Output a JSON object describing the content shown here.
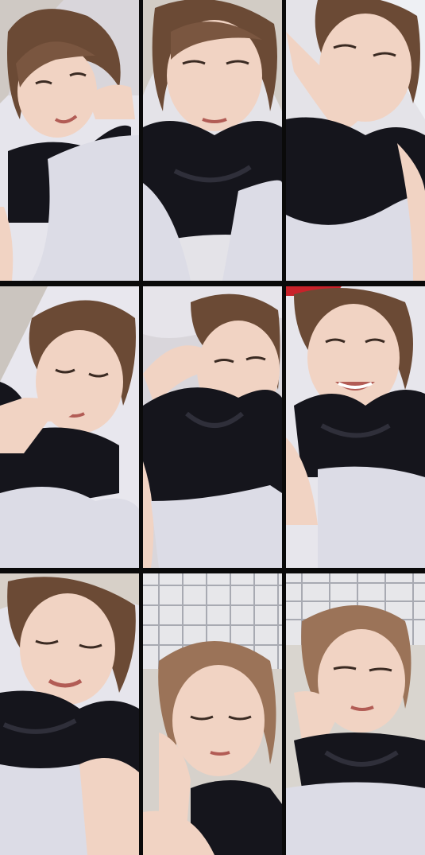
{
  "collage": {
    "rows": 3,
    "columns": 3,
    "panels": [
      {
        "name": "panel-1",
        "scene": "bed",
        "pose": "hand-near-chin"
      },
      {
        "name": "panel-2",
        "scene": "bed",
        "pose": "looking-down"
      },
      {
        "name": "panel-3",
        "scene": "bed",
        "pose": "hand-over-mouth"
      },
      {
        "name": "panel-4",
        "scene": "bed",
        "pose": "finger-on-chin"
      },
      {
        "name": "panel-5",
        "scene": "bed",
        "pose": "hand-at-hair"
      },
      {
        "name": "panel-6",
        "scene": "bed",
        "pose": "laughing"
      },
      {
        "name": "panel-7",
        "scene": "bed",
        "pose": "smiling-eyes-closed"
      },
      {
        "name": "panel-8",
        "scene": "ceiling-grid",
        "pose": "hand-on-cheek"
      },
      {
        "name": "panel-9",
        "scene": "ceiling-grid",
        "pose": "chin-on-hand"
      }
    ]
  },
  "colors": {
    "border": "#0a0a0a",
    "skin": "#f1d3c3",
    "skin_shadow": "#ddb39f",
    "hair": "#6b4a35",
    "hair_light": "#9b7358",
    "shirt": "#15151c",
    "sheet": "#dcdce6",
    "sheet_shadow": "#b9bac8",
    "wall": "#d9d3cc",
    "ceiling": "#e7e7ea",
    "grid_line": "#a8aab2",
    "red_accent": "#c8222a"
  }
}
